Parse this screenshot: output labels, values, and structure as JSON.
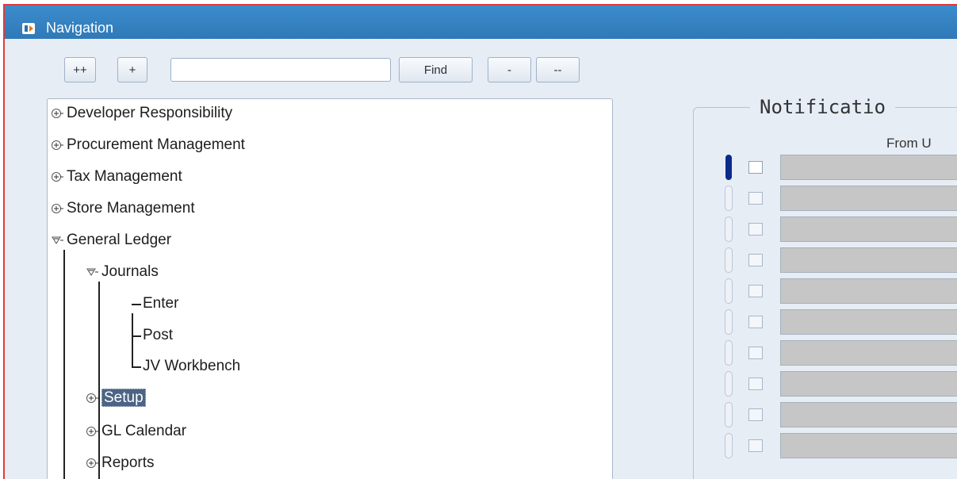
{
  "window": {
    "title": "Navigation"
  },
  "toolbar": {
    "expand_all_label": "++",
    "expand_label": "+",
    "search_value": "",
    "find_label": "Find",
    "collapse_label": "-",
    "collapse_all_label": "--"
  },
  "tree": {
    "nodes": [
      {
        "label": "Developer Responsibility",
        "state": "collapsed"
      },
      {
        "label": "Procurement Management",
        "state": "collapsed"
      },
      {
        "label": "Tax Management",
        "state": "collapsed"
      },
      {
        "label": "Store Management",
        "state": "collapsed"
      },
      {
        "label": "General Ledger",
        "state": "expanded"
      },
      {
        "label": "Journals",
        "state": "expanded"
      },
      {
        "label": "Enter",
        "state": "leaf"
      },
      {
        "label": "Post",
        "state": "leaf"
      },
      {
        "label": "JV Workbench",
        "state": "leaf"
      },
      {
        "label": "Setup",
        "state": "collapsed",
        "selected": true
      },
      {
        "label": "GL Calendar",
        "state": "collapsed"
      },
      {
        "label": "Reports",
        "state": "collapsed"
      }
    ]
  },
  "notifications": {
    "title": "Notificatio",
    "from_header": "From U",
    "row_count": 10,
    "active_row": 1
  },
  "colors": {
    "titlebar": "#2f79b8",
    "selection": "#4b6384",
    "border_accent": "#e23a3a"
  }
}
